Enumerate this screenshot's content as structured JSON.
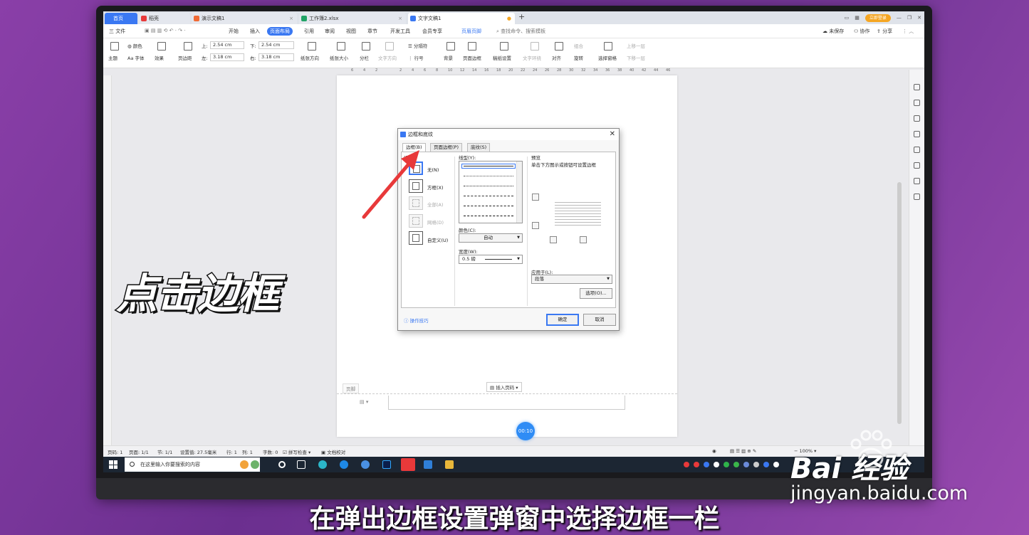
{
  "tabs": {
    "home": "首页",
    "docer": "稻壳",
    "demo": "演示文稿1",
    "sheet": "工作簿2.xlsx",
    "doc": "文字文稿1",
    "plus": "+",
    "login": "立即登录"
  },
  "menubar": {
    "file": "三 文件",
    "items": [
      "开始",
      "插入",
      "页面布局",
      "引用",
      "审阅",
      "视图",
      "章节",
      "开发工具",
      "会员专享",
      "页眉页脚"
    ],
    "search": "查找命令、搜索模板",
    "unsaved": "未保存",
    "collab": "协作",
    "share": "分享"
  },
  "ribbon": {
    "theme": "主题",
    "colors": "颜色",
    "fonts": "Aa 字体",
    "effects": "效果",
    "margins": "页边距",
    "top_label": "上:",
    "top_value": "2.54 cm",
    "bottom_label": "下:",
    "bottom_value": "2.54 cm",
    "left_label": "左:",
    "left_value": "3.18 cm",
    "right_label": "右:",
    "right_value": "3.18 cm",
    "orientation": "纸张方向",
    "size": "纸张大小",
    "columns": "分栏",
    "text_direction": "文字方向",
    "breaks": "分隔符",
    "line_numbers": "行号",
    "background": "背景",
    "page_border": "页面边框",
    "manuscript": "稿纸设置",
    "wrap": "文字环绕",
    "align": "对齐",
    "rotate": "旋转",
    "group": "组合",
    "selection_pane": "选择窗格",
    "bring_forward": "上移一层",
    "send_backward": "下移一层"
  },
  "ruler": [
    "6",
    "4",
    "2",
    "",
    "2",
    "4",
    "6",
    "8",
    "10",
    "12",
    "14",
    "16",
    "18",
    "20",
    "22",
    "24",
    "26",
    "28",
    "30",
    "32",
    "34",
    "36",
    "38",
    "40",
    "42",
    "44",
    "46"
  ],
  "page": {
    "footer_label": "页脚",
    "insert_page_number": "插入页码",
    "timer": "00:10"
  },
  "dialog": {
    "title": "边框和底纹",
    "tabs": [
      "边框(B)",
      "页面边框(P)",
      "底纹(S)"
    ],
    "setting_label": "设置:",
    "settings": [
      {
        "label": "无(N)",
        "enabled": true
      },
      {
        "label": "方框(X)",
        "enabled": true
      },
      {
        "label": "全部(A)",
        "enabled": false
      },
      {
        "label": "网格(D)",
        "enabled": false
      },
      {
        "label": "自定义(U)",
        "enabled": true
      }
    ],
    "line_style_label": "线型(Y):",
    "color_label": "颜色(C):",
    "color_value": "自动",
    "width_label": "宽度(W):",
    "width_value": "0.5 磅",
    "preview_label": "预览",
    "preview_hint": "单击下方图示或按钮可设置边框",
    "apply_to_label": "应用于(L):",
    "apply_to_value": "段落",
    "options_button": "选项(O)...",
    "tips": "操作技巧",
    "ok": "确定",
    "cancel": "取消"
  },
  "status": {
    "page": "页码: 1",
    "pages": "页面: 1/1",
    "section": "节: 1/1",
    "setting": "设置值: 27.5毫米",
    "line": "行: 1",
    "col": "列: 1",
    "words": "字数: 0",
    "spell": "拼写检查",
    "proof": "文档校对",
    "zoom": "100%"
  },
  "taskbar": {
    "search_placeholder": "在这里输入你要搜索的内容"
  },
  "overlay": {
    "big_text": "点击边框",
    "caption": "在弹出边框设置弹窗中选择边框一栏"
  },
  "watermark": {
    "logo": "Bai 经验",
    "url": "jingyan.baidu.com"
  },
  "colors": {
    "accent": "#3a78f2",
    "arrow": "#e8393a",
    "background": "#7a3a9c"
  }
}
